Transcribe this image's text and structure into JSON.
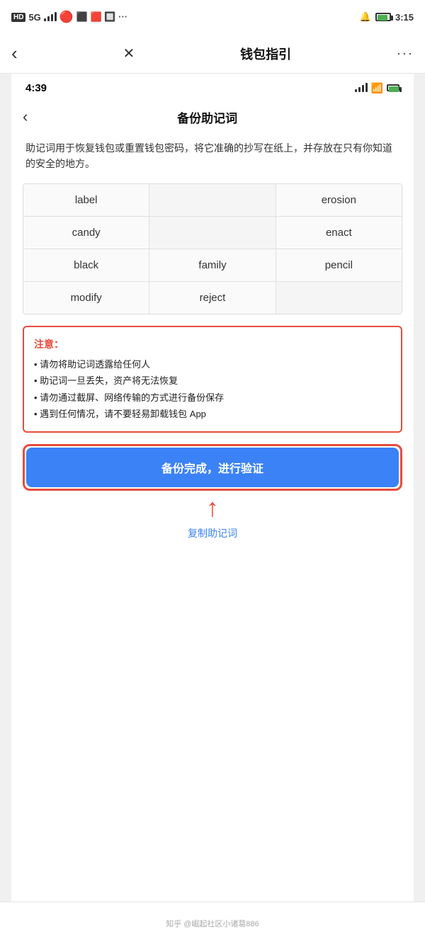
{
  "outer_status": {
    "time": "3:15",
    "left_icons": "HD 5G",
    "right_label": "3:15"
  },
  "outer_nav": {
    "title": "钱包指引",
    "back_icon": "‹",
    "close_icon": "✕",
    "more_icon": "···"
  },
  "inner_status": {
    "time": "4:39"
  },
  "inner_nav": {
    "title": "备份助记词",
    "back_icon": "‹"
  },
  "description": "助记词用于恢复钱包或重置钱包密码，将它准确的抄写在纸上，并存放在只有你知道的安全的地方。",
  "mnemonic_words": [
    [
      "label",
      "",
      "erosion"
    ],
    [
      "candy",
      "",
      "enact"
    ],
    [
      "black",
      "family",
      "pencil"
    ],
    [
      "modify",
      "reject",
      ""
    ]
  ],
  "warning": {
    "title": "注意：",
    "items": [
      "• 请勿将助记词透露给任何人",
      "• 助记词一旦丢失，资产将无法恢复",
      "• 请勿通过截屏、网络传输的方式进行备份保存",
      "• 遇到任何情况，请不要轻易卸载钱包 App"
    ]
  },
  "backup_button": "备份完成，进行验证",
  "copy_link": "复制助记词",
  "bottom_watermark": "知乎 @崛起社区小诸葛886"
}
